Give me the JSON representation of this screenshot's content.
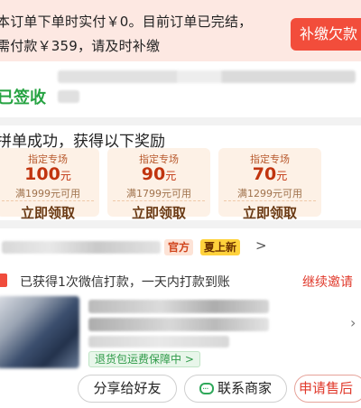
{
  "notice": {
    "line1": "本订单下单时实付￥0。目前订单已完结，",
    "line2": "需付款￥359，请及时补缴",
    "repay_button": "补缴欠款"
  },
  "logistics": {
    "status": "已签收",
    "colors": {
      "status": "#26a342"
    }
  },
  "rewards": {
    "title": "拼单成功，获得以下奖励",
    "coupons": [
      {
        "tag": "指定专场",
        "amount": "100",
        "unit": "元",
        "condition": "满1999元可用",
        "claim_label": "立即领取"
      },
      {
        "tag": "指定专场",
        "amount": "90",
        "unit": "元",
        "condition": "满1799元可用",
        "claim_label": "立即领取"
      },
      {
        "tag": "指定专场",
        "amount": "70",
        "unit": "元",
        "condition": "满1299元可用",
        "claim_label": "立即领取"
      }
    ]
  },
  "shop": {
    "badge_official": "官方",
    "badge_new": "夏上新",
    "arrow": ">"
  },
  "wechat": {
    "text": "已获得1次微信打款，一天内打款到账",
    "invite_link": "继续邀请"
  },
  "product": {
    "guarantee": "退货包运费保障中 >",
    "chevron": "›"
  },
  "actions": {
    "share": "分享给好友",
    "contact": "联系商家",
    "aftersale": "申请售后"
  },
  "colors": {
    "accent_red": "#f24d3b",
    "notice_bg": "#fde8e2",
    "coupon_bg": "#fdf1e6",
    "official_badge": "#d0431a",
    "new_badge": "#ffd23c",
    "guarantee_green": "#2e9a48"
  }
}
